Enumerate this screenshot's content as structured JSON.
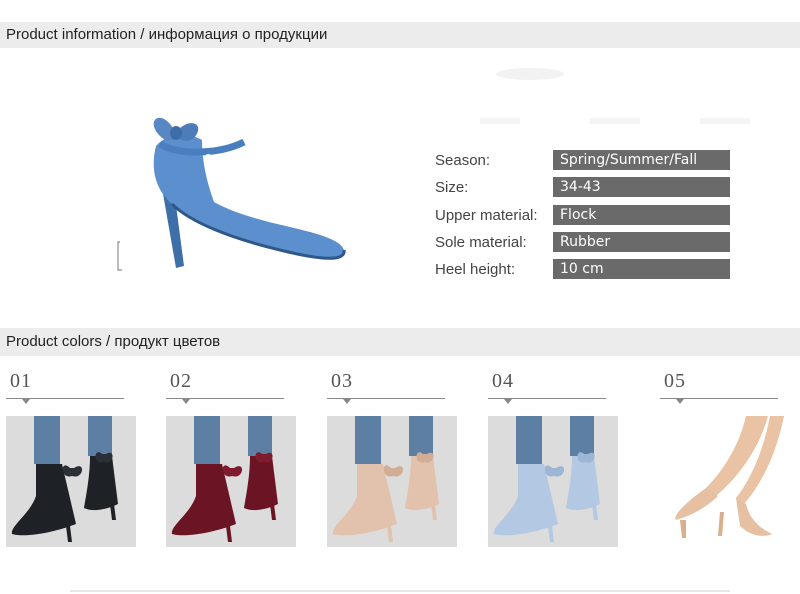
{
  "sections": {
    "info_title": "Product information / информация о продукции",
    "colors_title": "Product colors / продукт цветов"
  },
  "specs": [
    {
      "label": "Season:",
      "value": "Spring/Summer/Fall"
    },
    {
      "label": "Size:",
      "value": "34-43"
    },
    {
      "label": "Upper material:",
      "value": "Flock"
    },
    {
      "label": "Sole material:",
      "value": "Rubber"
    },
    {
      "label": "Heel height:",
      "value": "10 cm"
    }
  ],
  "colors": [
    {
      "number": "01",
      "swatch": "#1e2226"
    },
    {
      "number": "02",
      "swatch": "#6b1424"
    },
    {
      "number": "03",
      "swatch": "#e2c2ad"
    },
    {
      "number": "04",
      "swatch": "#b3c8e2"
    },
    {
      "number": "05",
      "swatch": "#e6c0a2"
    }
  ],
  "theme": {
    "bar_background": "#ececec",
    "value_background": "#6a6a6a",
    "hero_color": "#5b8fcd",
    "jeans_color": "#5d7fa3",
    "photo_background": "#dcdcdc"
  }
}
